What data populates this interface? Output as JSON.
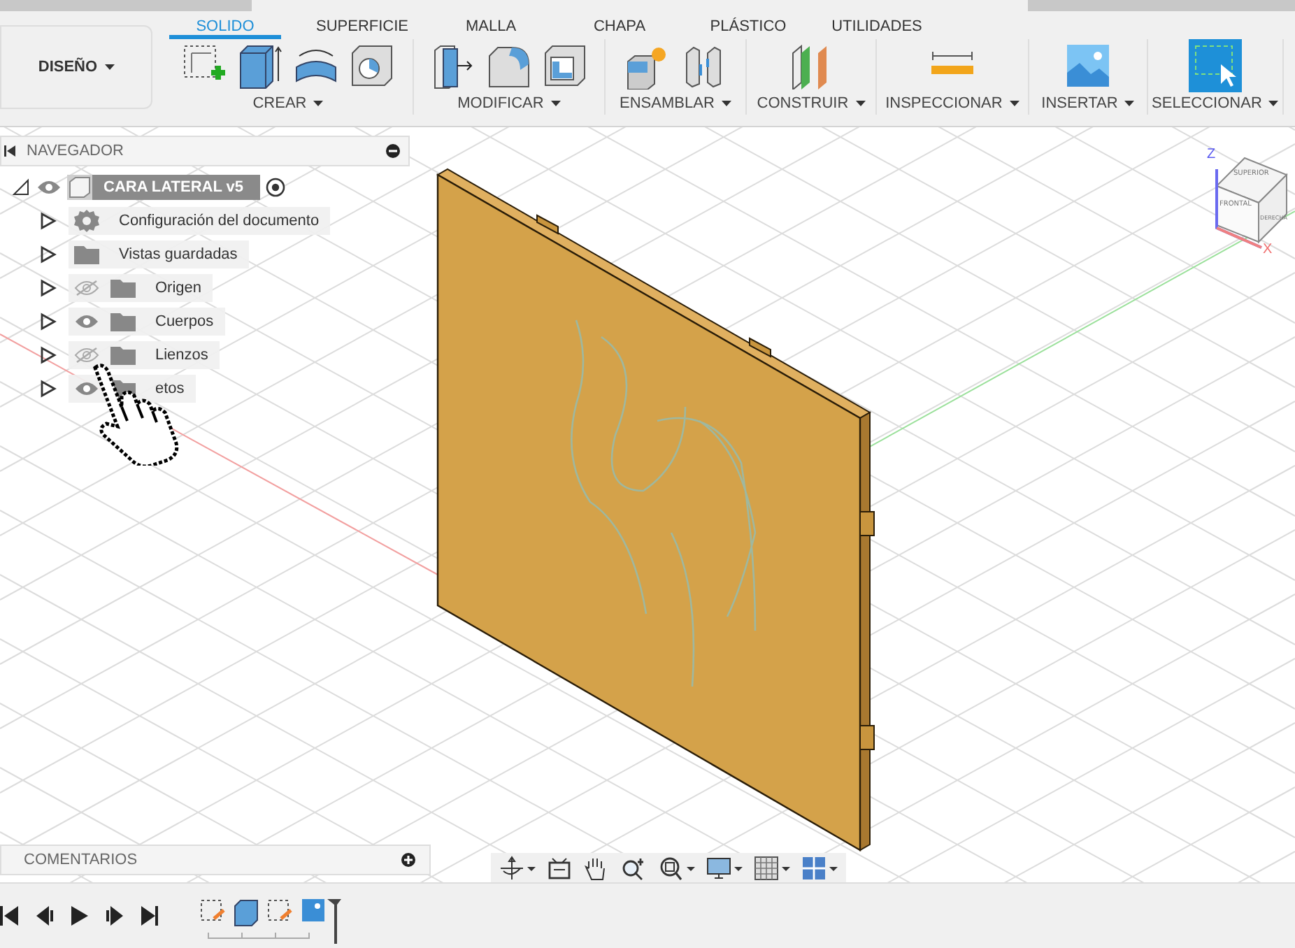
{
  "workspace": {
    "label": "DISEÑO"
  },
  "tabs": [
    {
      "label": "SOLIDO",
      "selected": true
    },
    {
      "label": "SUPERFICIE",
      "selected": false
    },
    {
      "label": "MALLA",
      "selected": false
    },
    {
      "label": "CHAPA",
      "selected": false
    },
    {
      "label": "PLÁSTICO",
      "selected": false
    },
    {
      "label": "UTILIDADES",
      "selected": false
    }
  ],
  "groups": [
    {
      "label": "CREAR"
    },
    {
      "label": "MODIFICAR"
    },
    {
      "label": "ENSAMBLAR"
    },
    {
      "label": "CONSTRUIR"
    },
    {
      "label": "INSPECCIONAR"
    },
    {
      "label": "INSERTAR"
    },
    {
      "label": "SELECCIONAR"
    }
  ],
  "browser": {
    "title": "NAVEGADOR",
    "root": {
      "label": "CARA LATERAL v5",
      "expanded": true,
      "visible": true
    },
    "items": [
      {
        "kind": "settings",
        "label": "Configuración del documento",
        "expanded": false
      },
      {
        "kind": "folder",
        "label": "Vistas guardadas",
        "expanded": false
      },
      {
        "kind": "folder",
        "label": "Origen",
        "expanded": false,
        "visible": false
      },
      {
        "kind": "folder",
        "label": "Cuerpos",
        "expanded": false,
        "visible": true
      },
      {
        "kind": "folder",
        "label": "Lienzos",
        "expanded": false,
        "visible": false
      },
      {
        "kind": "folder",
        "label": "etos",
        "expanded": false,
        "visible": true
      }
    ]
  },
  "viewcube": {
    "top": "SUPERIOR",
    "front": "FRONTAL",
    "right": "DERECHA",
    "z_axis": "Z",
    "x_axis": "X"
  },
  "comments": {
    "title": "COMENTARIOS"
  }
}
